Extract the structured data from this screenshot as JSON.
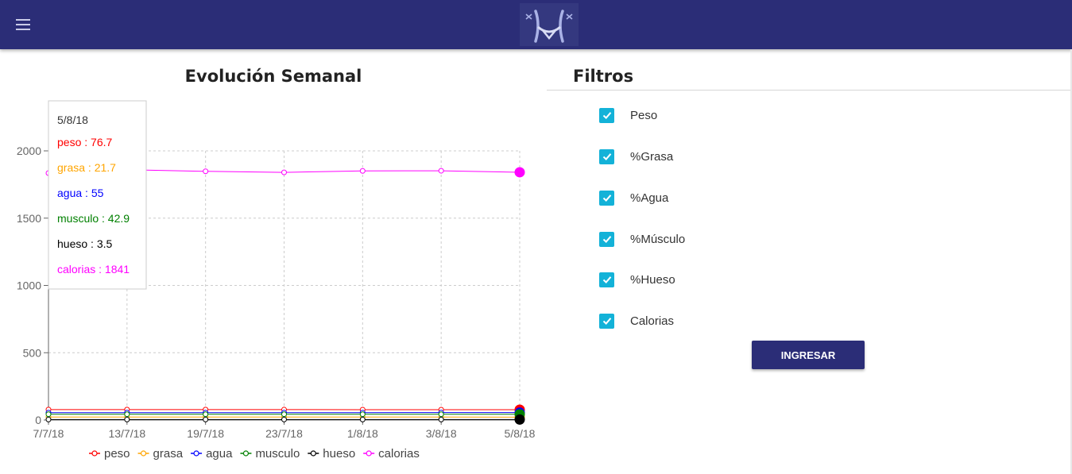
{
  "colors": {
    "appbar": "#2b2d77",
    "checkbox": "#13b2d8",
    "peso": "#ff0000",
    "grasa": "#ffa500",
    "agua": "#0000ff",
    "musculo": "#008000",
    "hueso": "#000000",
    "calorias": "#ff00ff"
  },
  "icons": {
    "menu": "menu-icon",
    "logo": "waist-logo-icon",
    "check": "check-icon"
  },
  "chart": {
    "title": "Evolución Semanal"
  },
  "chart_data": {
    "type": "line",
    "title": "Evolución Semanal",
    "x": [
      "7/7/18",
      "13/7/18",
      "19/7/18",
      "23/7/18",
      "1/8/18",
      "3/8/18",
      "5/8/18"
    ],
    "ylim": [
      0,
      2000
    ],
    "yticks": [
      "0",
      "500",
      "1000",
      "1500",
      "2000"
    ],
    "grid": true,
    "legend_position": "bottom",
    "series": [
      {
        "name": "peso",
        "key": "peso",
        "values": [
          77.8,
          77.6,
          77.4,
          77.1,
          77.0,
          76.9,
          76.7
        ]
      },
      {
        "name": "grasa",
        "key": "grasa",
        "values": [
          22.2,
          22.1,
          22.0,
          21.9,
          21.8,
          21.8,
          21.7
        ]
      },
      {
        "name": "agua",
        "key": "agua",
        "values": [
          54.6,
          54.7,
          54.8,
          54.8,
          54.9,
          55.0,
          55
        ]
      },
      {
        "name": "musculo",
        "key": "musculo",
        "values": [
          42.6,
          42.6,
          42.7,
          42.7,
          42.8,
          42.8,
          42.9
        ]
      },
      {
        "name": "hueso",
        "key": "hueso",
        "values": [
          3.5,
          3.5,
          3.5,
          3.5,
          3.5,
          3.5,
          3.5
        ]
      },
      {
        "name": "calorias",
        "key": "calorias",
        "values": [
          1835,
          1860,
          1848,
          1840,
          1851,
          1852,
          1841
        ]
      }
    ],
    "tooltip": {
      "date": "5/8/18",
      "lines": [
        "peso : 76.7",
        "grasa : 21.7",
        "agua : 55",
        "musculo : 42.9",
        "hueso : 3.5",
        "calorias : 1841"
      ]
    }
  },
  "filters": {
    "title": "Filtros",
    "items": [
      {
        "label": "Peso",
        "checked": true
      },
      {
        "label": "%Grasa",
        "checked": true
      },
      {
        "label": "%Agua",
        "checked": true
      },
      {
        "label": "%Músculo",
        "checked": true
      },
      {
        "label": "%Hueso",
        "checked": true
      },
      {
        "label": "Calorias",
        "checked": true
      }
    ],
    "submit_label": "INGRESAR"
  }
}
